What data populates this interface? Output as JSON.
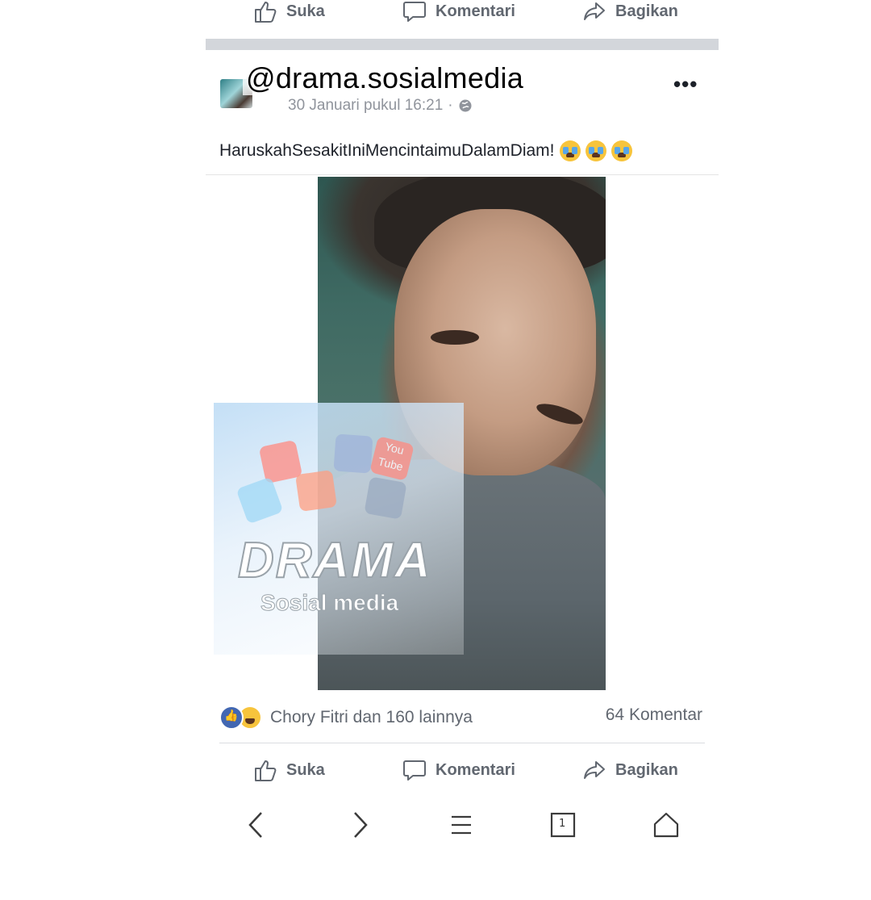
{
  "top_actions": {
    "like_label": "Suka",
    "comment_label": "Komentari",
    "share_label": "Bagikan"
  },
  "post": {
    "overlay_handle": "@drama.sosialmedia",
    "timestamp": "30 Januari pukul 16:21",
    "privacy_icon": "globe-icon",
    "more_icon": "more-options-icon",
    "caption": "HaruskahSesakitIniMencintaimuDalamDiam!",
    "caption_emojis": [
      "loudly-crying-face",
      "loudly-crying-face",
      "loudly-crying-face"
    ],
    "watermark": {
      "title": "DRAMA",
      "subtitle": "Sosial media",
      "logo_text": "You Tube"
    }
  },
  "reactions": {
    "summary": "Chory Fitri dan 160 lainnya",
    "comments": "64 Komentar",
    "types": [
      "like",
      "haha"
    ]
  },
  "bottom_actions": {
    "like_label": "Suka",
    "comment_label": "Komentari",
    "share_label": "Bagikan"
  },
  "browser_nav": {
    "tab_count": "1",
    "icons": [
      "back-icon",
      "forward-icon",
      "menu-icon",
      "tabs-icon",
      "home-icon"
    ]
  },
  "colors": {
    "accent": "#4267b2",
    "separator": "#d3d6db",
    "action_text": "#616770"
  }
}
